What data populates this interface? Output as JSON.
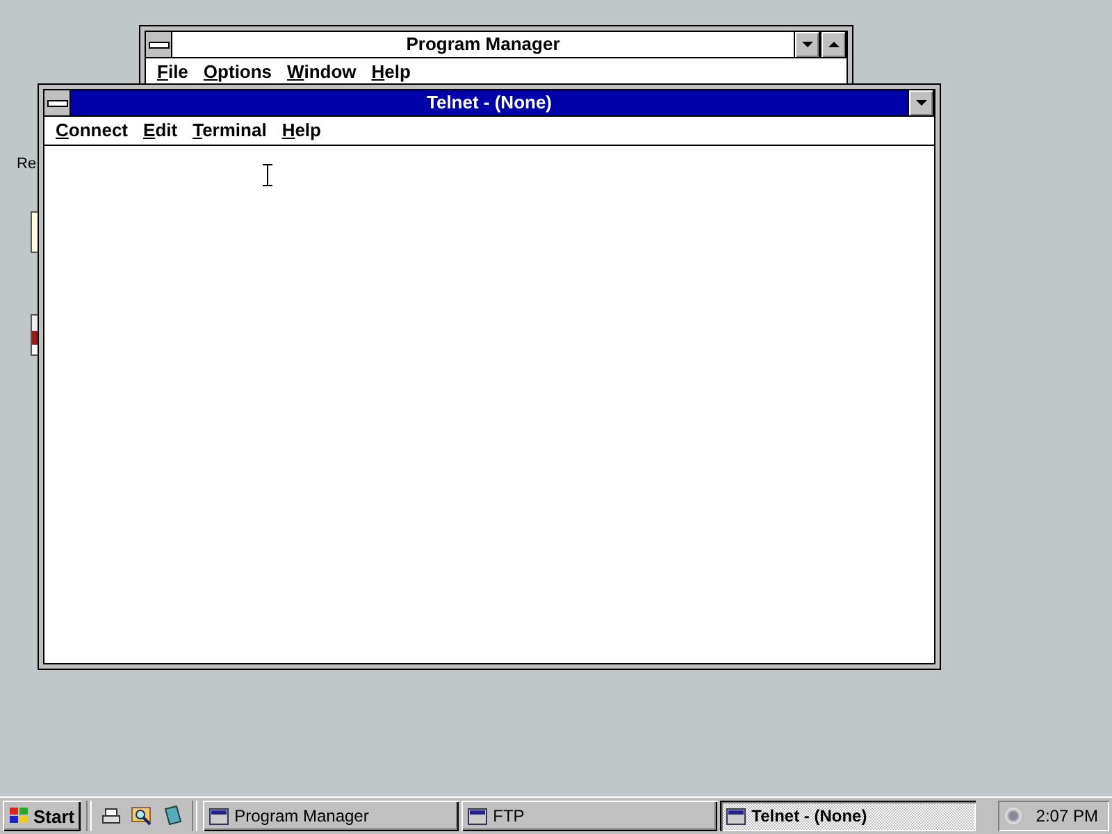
{
  "desktop_icons": [
    {
      "kind": "label",
      "lines": [
        "Re"
      ]
    },
    {
      "kind": "note"
    },
    {
      "kind": "card"
    }
  ],
  "windows": [
    {
      "title": "Program Manager",
      "active": false,
      "menu": [
        "File",
        "Options",
        "Window",
        "Help"
      ]
    },
    {
      "title": "Telnet - (None)",
      "active": true,
      "menu": [
        "Connect",
        "Edit",
        "Terminal",
        "Help"
      ]
    }
  ],
  "taskbar": {
    "start": "Start",
    "buttons": [
      {
        "label": "Program Manager",
        "selected": false
      },
      {
        "label": "FTP",
        "selected": false
      },
      {
        "label": "Telnet - (None)",
        "selected": true
      }
    ],
    "clock": "2:07 PM"
  }
}
